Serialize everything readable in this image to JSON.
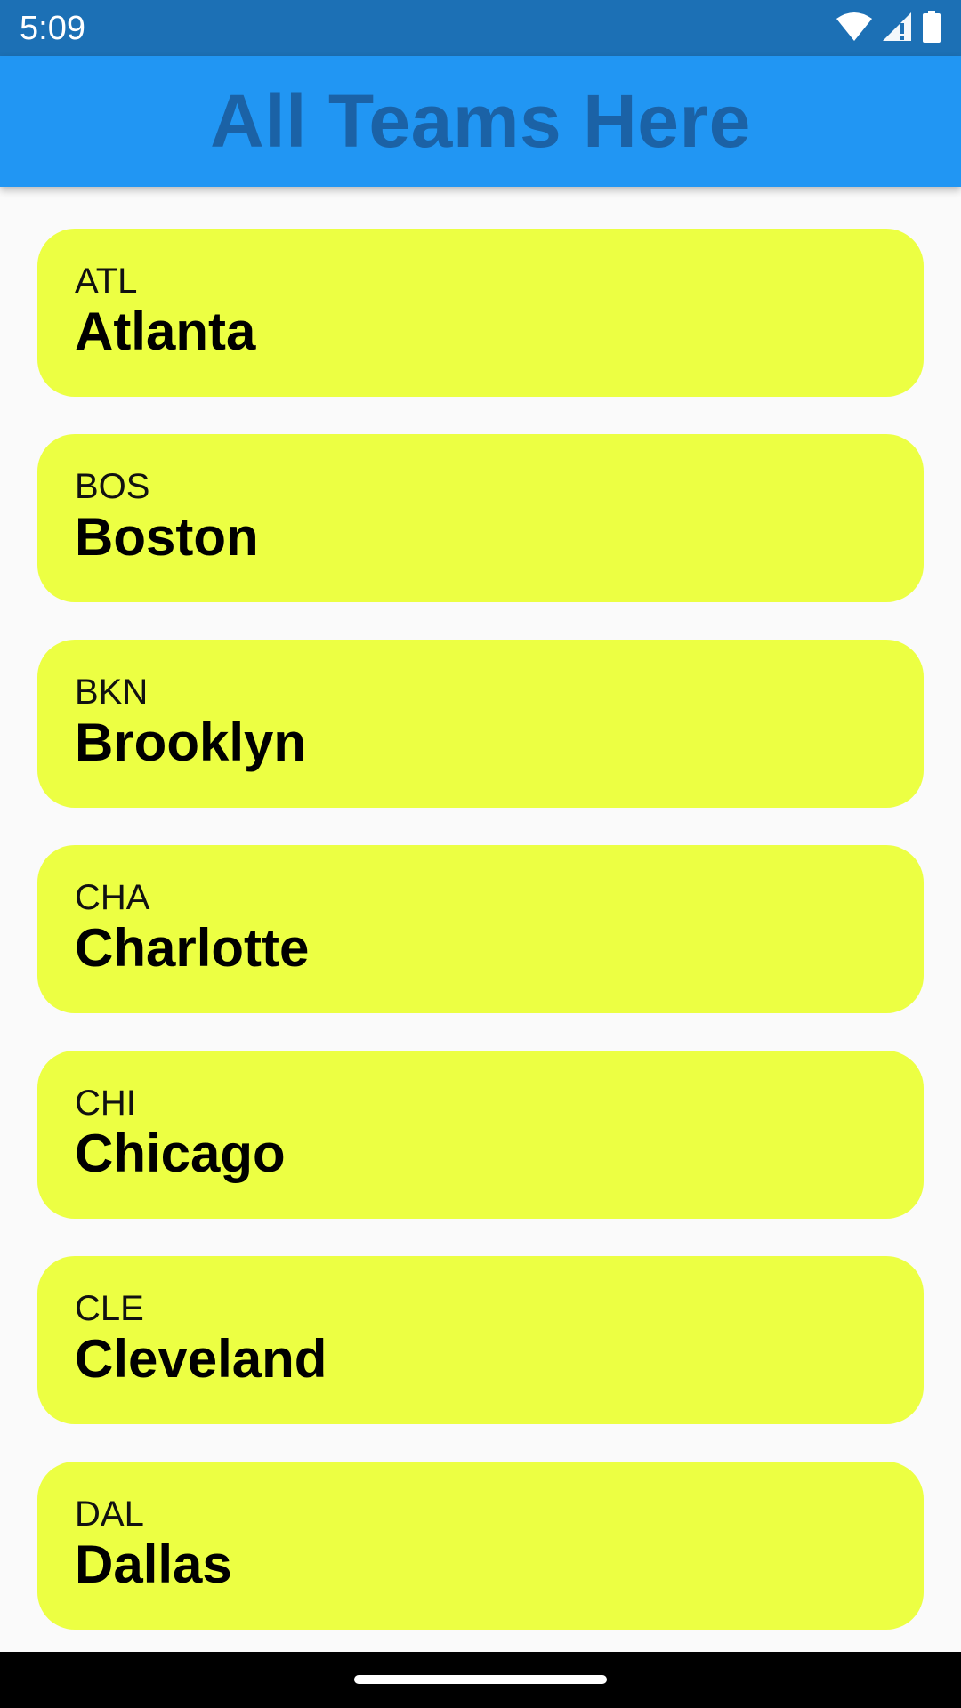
{
  "status_bar": {
    "time": "5:09",
    "icons": [
      "wifi-icon",
      "signal-icon",
      "battery-icon"
    ]
  },
  "app_bar": {
    "title": "All Teams Here"
  },
  "teams": [
    {
      "abbr": "ATL",
      "city": "Atlanta"
    },
    {
      "abbr": "BOS",
      "city": "Boston"
    },
    {
      "abbr": "BKN",
      "city": "Brooklyn"
    },
    {
      "abbr": "CHA",
      "city": "Charlotte"
    },
    {
      "abbr": "CHI",
      "city": "Chicago"
    },
    {
      "abbr": "CLE",
      "city": "Cleveland"
    },
    {
      "abbr": "DAL",
      "city": "Dallas"
    }
  ],
  "colors": {
    "status_bar": "#1c70b5",
    "app_bar": "#2196f3",
    "title_text": "#1b62a6",
    "card": "#ecff43",
    "background": "#fafafa"
  }
}
